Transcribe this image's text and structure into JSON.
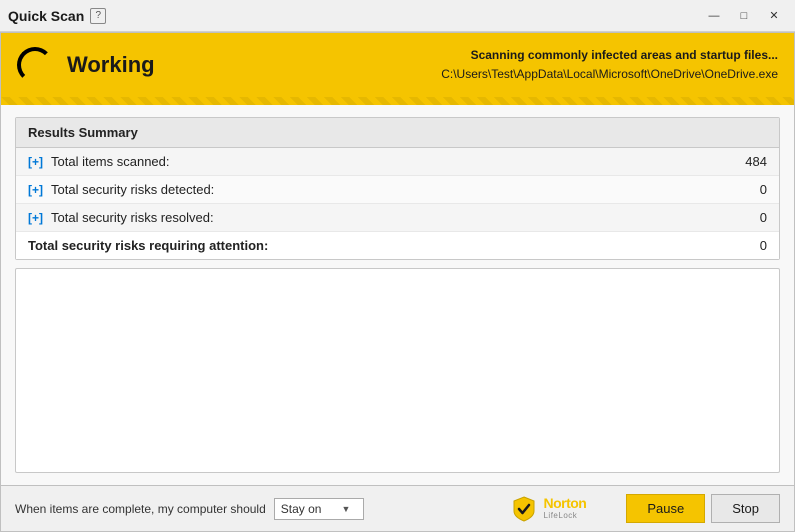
{
  "titlebar": {
    "title": "Quick Scan",
    "help_label": "?",
    "min_btn": "—",
    "max_btn": "□",
    "close_btn": "✕"
  },
  "status": {
    "working_label": "Working",
    "scan_title": "Scanning commonly infected areas and startup files...",
    "scan_path": "C:\\Users\\Test\\AppData\\Local\\Microsoft\\OneDrive\\OneDrive.exe"
  },
  "results": {
    "header": "Results Summary",
    "rows": [
      {
        "expand": "[+]",
        "label": "Total items scanned:",
        "value": "484",
        "has_expand": true
      },
      {
        "expand": "[+]",
        "label": "Total security risks detected:",
        "value": "0",
        "has_expand": true
      },
      {
        "expand": "[+]",
        "label": "Total security risks resolved:",
        "value": "0",
        "has_expand": true
      },
      {
        "label": "Total security risks requiring attention:",
        "value": "0",
        "has_expand": false
      }
    ]
  },
  "bottom": {
    "when_label": "When items are complete, my computer should",
    "dropdown_value": "Stay on",
    "norton_name": "Norton",
    "norton_sub": "LifeLock",
    "pause_btn": "Pause",
    "stop_btn": "Stop"
  }
}
